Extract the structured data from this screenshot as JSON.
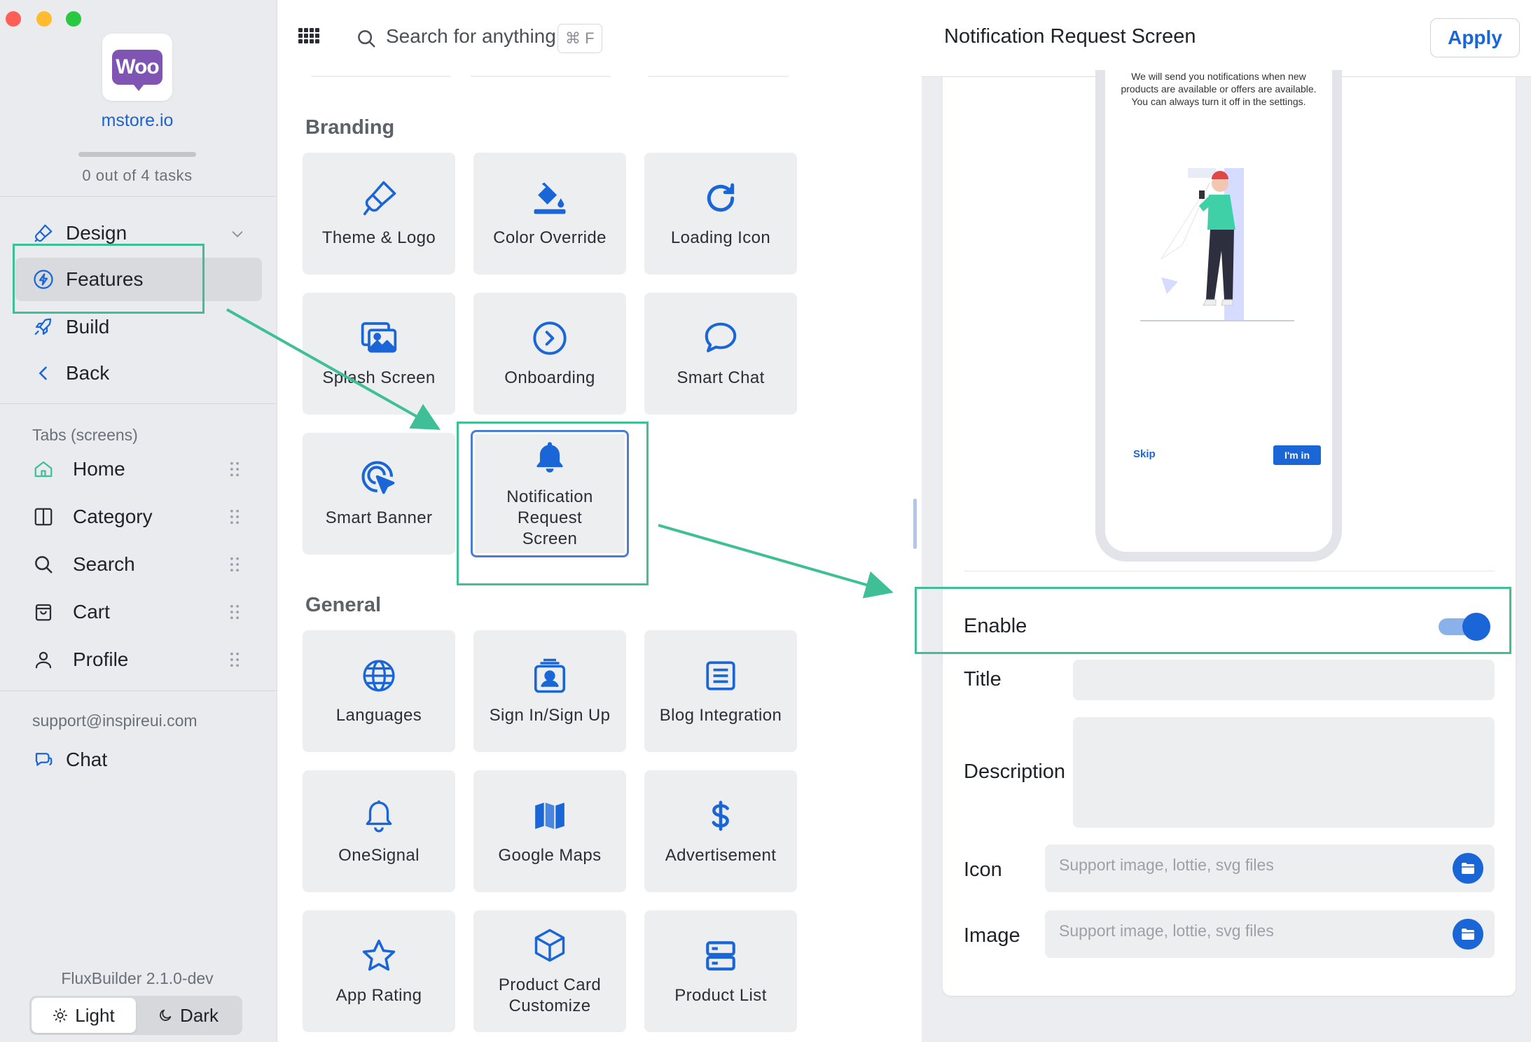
{
  "window": {
    "controls": [
      "close",
      "minimize",
      "zoom"
    ]
  },
  "sidebar": {
    "logo_text": "Woo",
    "store_name": "mstore.io",
    "progress": {
      "done": 0,
      "total": 4,
      "text": "0 out of 4 tasks"
    },
    "nav": [
      {
        "label": "Design",
        "icon": "paintbrush-icon",
        "expandable": true
      },
      {
        "label": "Features",
        "icon": "lightning-icon",
        "active": true
      },
      {
        "label": "Build",
        "icon": "rocket-icon"
      },
      {
        "label": "Back",
        "icon": "chevron-left-icon"
      }
    ],
    "tabs_label": "Tabs (screens)",
    "tabs": [
      {
        "label": "Home",
        "icon": "home-icon"
      },
      {
        "label": "Category",
        "icon": "columns-icon"
      },
      {
        "label": "Search",
        "icon": "search-icon"
      },
      {
        "label": "Cart",
        "icon": "bag-icon"
      },
      {
        "label": "Profile",
        "icon": "user-icon"
      }
    ],
    "support_email": "support@inspireui.com",
    "chat_label": "Chat",
    "version": "FluxBuilder 2.1.0-dev",
    "theme": {
      "light": "Light",
      "dark": "Dark",
      "selected": "Light"
    }
  },
  "middle": {
    "search_placeholder": "Search for anything",
    "search_shortcut": "⌘ F",
    "groups": [
      {
        "title": "Branding",
        "tiles": [
          {
            "label": "Theme & Logo",
            "icon": "paintbrush-icon"
          },
          {
            "label": "Color Override",
            "icon": "paint-bucket-icon"
          },
          {
            "label": "Loading Icon",
            "icon": "refresh-icon"
          },
          {
            "label": "Splash Screen",
            "icon": "images-icon"
          },
          {
            "label": "Onboarding",
            "icon": "circle-chevron-right-icon"
          },
          {
            "label": "Smart Chat",
            "icon": "chat-bubble-icon"
          },
          {
            "label": "Smart Banner",
            "icon": "target-pointer-icon"
          },
          {
            "label": "Notification Request Screen",
            "icon": "bell-icon",
            "selected": true
          }
        ]
      },
      {
        "title": "General",
        "tiles": [
          {
            "label": "Languages",
            "icon": "globe-icon"
          },
          {
            "label": "Sign In/Sign Up",
            "icon": "id-card-icon"
          },
          {
            "label": "Blog Integration",
            "icon": "document-icon"
          },
          {
            "label": "OneSignal",
            "icon": "bell-outline-icon"
          },
          {
            "label": "Google Maps",
            "icon": "map-icon"
          },
          {
            "label": "Advertisement",
            "icon": "dollar-icon"
          },
          {
            "label": "App Rating",
            "icon": "star-icon"
          },
          {
            "label": "Product Card Customize",
            "icon": "cube-icon"
          },
          {
            "label": "Product List",
            "icon": "server-icon"
          }
        ]
      }
    ]
  },
  "right": {
    "title": "Notification Request Screen",
    "apply_label": "Apply",
    "preview": {
      "message": "We will send you notifications when new products are available or offers are available. You can always turn it off in the settings.",
      "skip_label": "Skip",
      "confirm_label": "I'm in"
    },
    "form": {
      "enable_label": "Enable",
      "enabled": true,
      "title_label": "Title",
      "title_value": "",
      "description_label": "Description",
      "description_value": "",
      "icon_label": "Icon",
      "icon_placeholder": "Support image, lottie, svg files",
      "image_label": "Image",
      "image_placeholder": "Support image, lottie, svg files"
    }
  },
  "colors": {
    "accent": "#1a66d6",
    "annotation": "#3fbf95",
    "sidebar_bg": "#e9ebee",
    "tile_bg": "#eceef0"
  }
}
